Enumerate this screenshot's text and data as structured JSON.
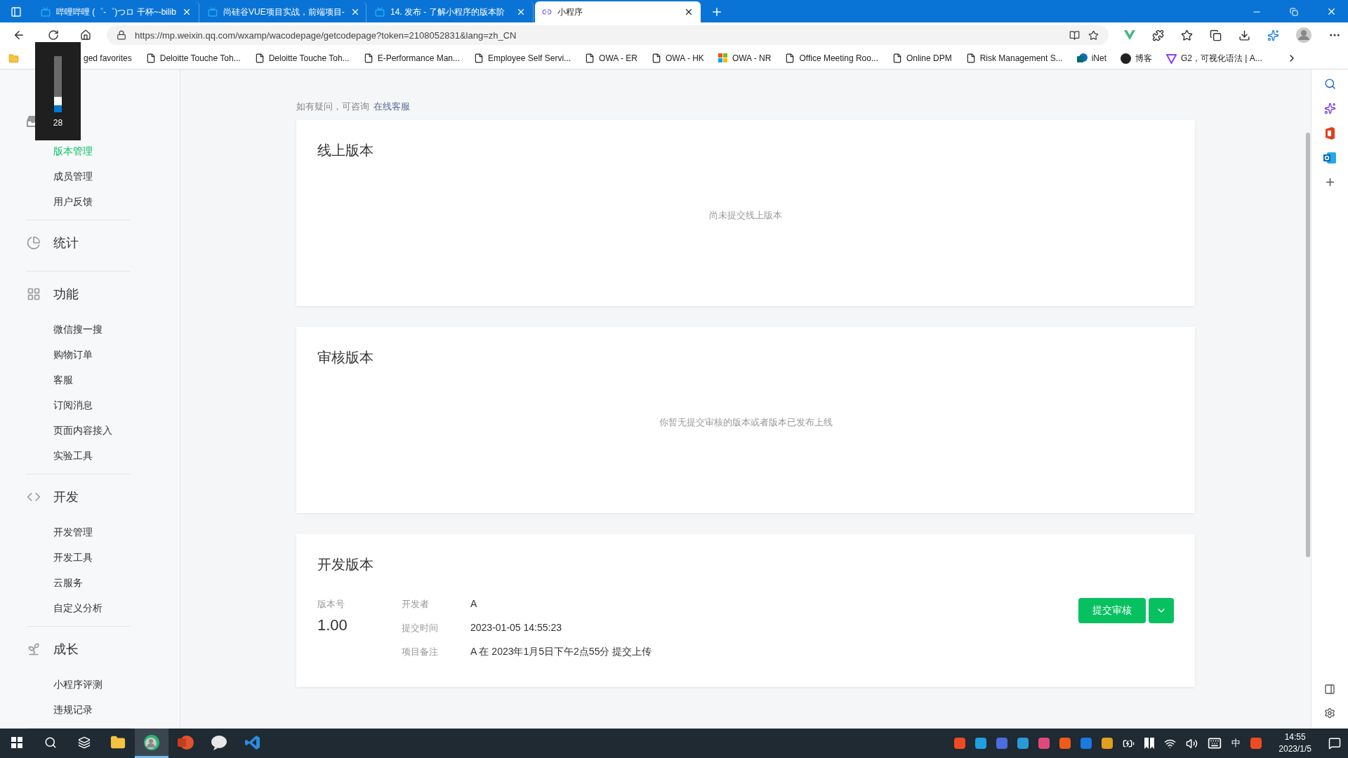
{
  "browser": {
    "tabs": [
      {
        "title": "哔哩哔哩 (゜-゜)つロ 干杯~-bilib",
        "kind": "tv",
        "selected": false
      },
      {
        "title": "尚硅谷VUE项目实战，前端项目-",
        "kind": "tv",
        "selected": false
      },
      {
        "title": "14. 发布 - 了解小程序的版本阶",
        "kind": "tv",
        "selected": false
      },
      {
        "title": "小程序",
        "kind": "link",
        "selected": true
      }
    ],
    "url": "https://mp.weixin.qq.com/wxamp/wacodepage/getcodepage?token=2108052831&lang=zh_CN",
    "bookmarks": [
      {
        "label": "ged favorites",
        "kind": "folder"
      },
      {
        "label": "Deloitte Touche Toh...",
        "kind": "page"
      },
      {
        "label": "Deloitte Touche Toh...",
        "kind": "page"
      },
      {
        "label": "E-Performance Man...",
        "kind": "page"
      },
      {
        "label": "Employee Self Servi...",
        "kind": "page"
      },
      {
        "label": "OWA - ER",
        "kind": "page"
      },
      {
        "label": "OWA - HK",
        "kind": "page"
      },
      {
        "label": "OWA - NR",
        "kind": "windows"
      },
      {
        "label": "Office Meeting Roo...",
        "kind": "page"
      },
      {
        "label": "Online DPM",
        "kind": "page"
      },
      {
        "label": "Risk Management S...",
        "kind": "page"
      },
      {
        "label": "iNet",
        "kind": "sharepoint"
      },
      {
        "label": "博客",
        "kind": "reco"
      },
      {
        "label": "G2，可视化语法 | A...",
        "kind": "g2"
      }
    ]
  },
  "volume_flyout": {
    "value": "28",
    "level": 0.28
  },
  "sidebar": {
    "groups": [
      {
        "kind": "inbox",
        "items": [
          {
            "label": "版本管理",
            "selected": true
          },
          {
            "label": "成员管理",
            "selected": false
          },
          {
            "label": "用户反馈",
            "selected": false
          }
        ]
      },
      {
        "title": "统计",
        "kind": "pie"
      },
      {
        "title": "功能",
        "kind": "grid",
        "items": [
          {
            "label": "微信搜一搜",
            "selected": false
          },
          {
            "label": "购物订单",
            "selected": false
          },
          {
            "label": "客服",
            "selected": false
          },
          {
            "label": "订阅消息",
            "selected": false
          },
          {
            "label": "页面内容接入",
            "selected": false
          },
          {
            "label": "实验工具",
            "selected": false
          }
        ]
      },
      {
        "title": "开发",
        "kind": "code",
        "items": [
          {
            "label": "开发管理",
            "selected": false
          },
          {
            "label": "开发工具",
            "selected": false
          },
          {
            "label": "云服务",
            "selected": false
          },
          {
            "label": "自定义分析",
            "selected": false
          }
        ]
      },
      {
        "title": "成长",
        "kind": "sprout",
        "items": [
          {
            "label": "小程序评测",
            "selected": false
          },
          {
            "label": "违规记录",
            "selected": false
          }
        ]
      }
    ]
  },
  "notice": {
    "text": "如有疑问，可咨询",
    "link": "在线客服"
  },
  "cards": [
    {
      "title": "线上版本",
      "kind": "empty",
      "message": "尚未提交线上版本"
    },
    {
      "title": "审核版本",
      "kind": "empty",
      "message": "你暂无提交审核的版本或者版本已发布上线"
    },
    {
      "title": "开发版本",
      "kind": "version",
      "version_label": "版本号",
      "version": "1.00",
      "fields": [
        {
          "label": "开发者",
          "value": "A"
        },
        {
          "label": "提交时间",
          "value": "2023-01-05 14:55:23"
        },
        {
          "label": "项目备注",
          "value": "A 在 2023年1月5日下午2点55分 提交上传"
        }
      ],
      "button": "提交审核"
    }
  ],
  "taskbar": {
    "apps": [
      {
        "kind": "start",
        "active": false
      },
      {
        "kind": "search",
        "active": false
      },
      {
        "kind": "taskview",
        "active": false
      },
      {
        "kind": "explorer",
        "active": false
      },
      {
        "kind": "edge",
        "active": true
      },
      {
        "kind": "ppt",
        "active": false
      },
      {
        "kind": "wechat",
        "active": false
      },
      {
        "kind": "vscode",
        "active": false
      }
    ],
    "tray": [
      {
        "color": "#f04a23"
      },
      {
        "color": "#1fa0e0"
      },
      {
        "color": "#4a6ee0"
      },
      {
        "color": "#2a9ad8"
      },
      {
        "color": "#e04a7a"
      },
      {
        "color": "#f05a1a"
      },
      {
        "color": "#1a7ae0"
      },
      {
        "color": "#e0a020"
      }
    ],
    "ime": "中",
    "time": "14:55",
    "date": "2023/1/5"
  }
}
